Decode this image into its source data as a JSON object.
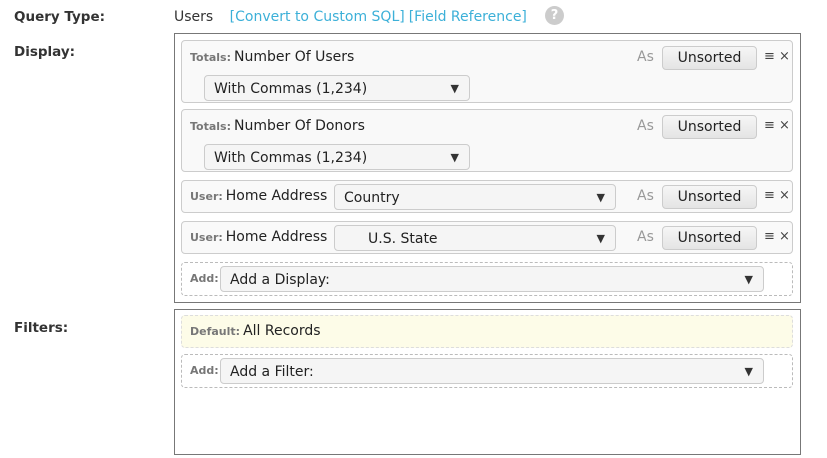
{
  "labels": {
    "query_type": "Query Type:",
    "display": "Display:",
    "filters": "Filters:"
  },
  "query": {
    "type": "Users",
    "convert": "[Convert to Custom SQL]",
    "field_ref": "[Field Reference]",
    "help": "?"
  },
  "display": [
    {
      "prefix": "Totals:",
      "name": "Number Of Users",
      "format": "With Commas (1,234)",
      "as": "As",
      "sort": "Unsorted"
    },
    {
      "prefix": "Totals:",
      "name": "Number Of Donors",
      "format": "With Commas (1,234)",
      "as": "As",
      "sort": "Unsorted"
    },
    {
      "prefix": "User:",
      "name": "Home Address",
      "format": "Country",
      "as": "As",
      "sort": "Unsorted"
    },
    {
      "prefix": "User:",
      "name": "Home Address",
      "format": "U.S. State",
      "as": "As",
      "sort": "Unsorted"
    }
  ],
  "add_display": {
    "prefix": "Add:",
    "placeholder": "Add a Display:"
  },
  "filters": {
    "default_prefix": "Default:",
    "default_value": "All Records",
    "add_prefix": "Add:",
    "add_placeholder": "Add a Filter:"
  },
  "icons": {
    "arrow": "▼",
    "menu": "≡",
    "close": "×"
  }
}
